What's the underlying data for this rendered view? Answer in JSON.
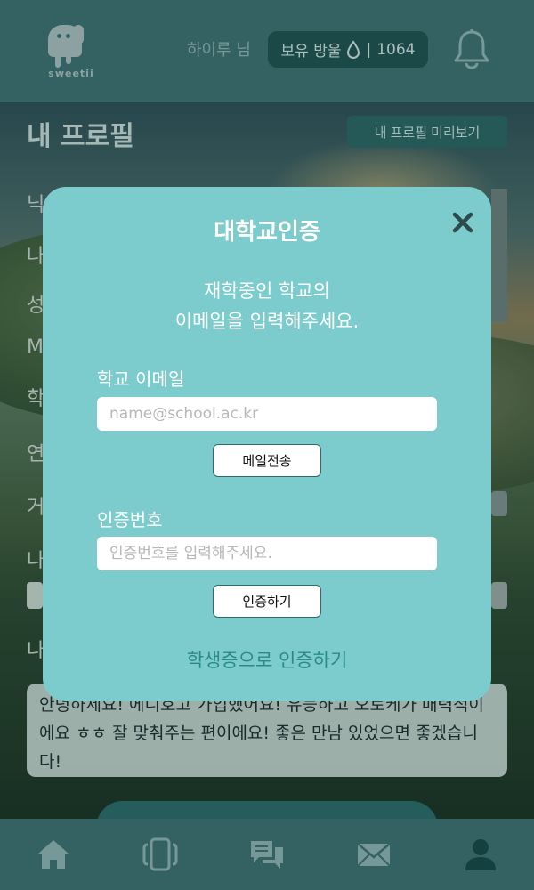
{
  "header": {
    "logo_text": "sweetii",
    "greeting": "하이루 님",
    "drops_label": "보유 방울",
    "drops_count": "1064"
  },
  "profile": {
    "title": "내 프로필",
    "preview_button": "내 프로필 미리보기",
    "intro_text": "안녕하세요! 에니호고 가입했어요! 유능하고 오토케가 매력적이에요 ㅎㅎ 잘 맞춰주는 편이에요! 좋은 만남 있었으면 좋겠습니다!"
  },
  "modal": {
    "title": "대학교인증",
    "subtitle_line1": "재학중인 학교의",
    "subtitle_line2": "이메일을 입력해주세요.",
    "email_label": "학교 이메일",
    "email_placeholder": "name@school.ac.kr",
    "send_button": "메일전송",
    "code_label": "인증번호",
    "code_placeholder": "인증번호를 입력해주세요.",
    "verify_button": "인증하기",
    "student_card_link": "학생증으로 인증하기"
  },
  "nav": {
    "items": [
      "home-icon",
      "cards-icon",
      "chat-icon",
      "mail-icon",
      "profile-icon"
    ],
    "active": "profile-icon"
  },
  "colors": {
    "header_bg": "#3e6f70",
    "modal_bg": "#7dcccd",
    "badge_bg": "#1f5150",
    "link_text": "#2c8a86"
  }
}
